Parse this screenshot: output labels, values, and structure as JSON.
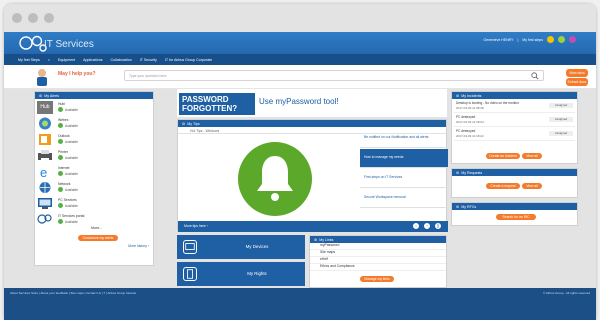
{
  "header": {
    "logo_text": "IT Services",
    "user_name": "Genevieve HENRY",
    "my_first_steps": "My first steps"
  },
  "nav": {
    "my_first_steps": "My first Steps",
    "items": [
      "Equipment",
      "Applications",
      "Collaboration",
      "IT Security",
      "IT for Airbus Group Corporate"
    ]
  },
  "help": {
    "title": "May I help you?",
    "search_placeholder": "Type your question here",
    "view_doc_label": "View docs",
    "extract_label": "Extract docs"
  },
  "apps": {
    "title": "My Alerts",
    "items": [
      {
        "name": "Hubi",
        "status": "Available",
        "icon": "hubi-icon"
      },
      {
        "name": "Webex",
        "status": "Available",
        "icon": "webex-icon"
      },
      {
        "name": "Outlook",
        "status": "Available",
        "icon": "outlook-icon"
      },
      {
        "name": "Printer",
        "status": "Available",
        "icon": "printer-icon"
      },
      {
        "name": "Internet",
        "status": "Available",
        "icon": "internet-icon"
      },
      {
        "name": "Network",
        "status": "Available",
        "icon": "network-icon"
      },
      {
        "name": "PC Services",
        "status": "Available",
        "icon": "pc-icon"
      },
      {
        "name": "IT Services portal",
        "status": "Available",
        "icon": "it-portal-icon"
      }
    ],
    "more_label": "More...",
    "customize_label": "Customize my alerts",
    "more_history_label": "More history"
  },
  "password": {
    "banner_title": "PASSWORD FORGOTTEN?",
    "link_text": "Use myPassword tool!"
  },
  "tips": {
    "title": "My Tips",
    "subtitle": "Hot Tips - Windows",
    "items": [
      "Be notified on our Notification and all alerts",
      "How to manage my needs",
      "First steps on IT Services",
      "Secure Workspace removal"
    ],
    "footer_label": "More tips here"
  },
  "quick": {
    "devices": "My Devices",
    "rights": "My Rights",
    "password_reset": "Quick password reset"
  },
  "links": {
    "title": "My Links",
    "items": [
      "myPassword",
      "Site maps",
      "eHelf",
      "Ethics and Compliance",
      "Security Services"
    ],
    "manage_label": "Manage my links"
  },
  "incidents": {
    "title": "My Incidents",
    "items": [
      {
        "title": "Desktop is booting - No video on the monitor",
        "date": "2017-03-03 11:38:38",
        "status": "Assigned"
      },
      {
        "title": "PC destroyed",
        "date": "2017-03-03 11:18:04",
        "status": "Assigned"
      },
      {
        "title": "PC destroyed",
        "date": "2017-03-03 11:18:22",
        "status": "Assigned"
      }
    ],
    "create_label": "Create an incident",
    "view_all_label": "View all"
  },
  "requests": {
    "title": "My Requests",
    "create_label": "Create a request",
    "view_all_label": "View all"
  },
  "rfcs": {
    "title": "My RFCs",
    "search_label": "Search for an RfC"
  },
  "footer": {
    "links": "About Services Store | About your feedback | Site maps | Contact Us | ? | Airbus Group Intranet",
    "right": "© Airbus Group - All rights reserved"
  },
  "colors": {
    "primary": "#1f5fa3",
    "accent": "#f47b2c",
    "available": "#56b144"
  }
}
